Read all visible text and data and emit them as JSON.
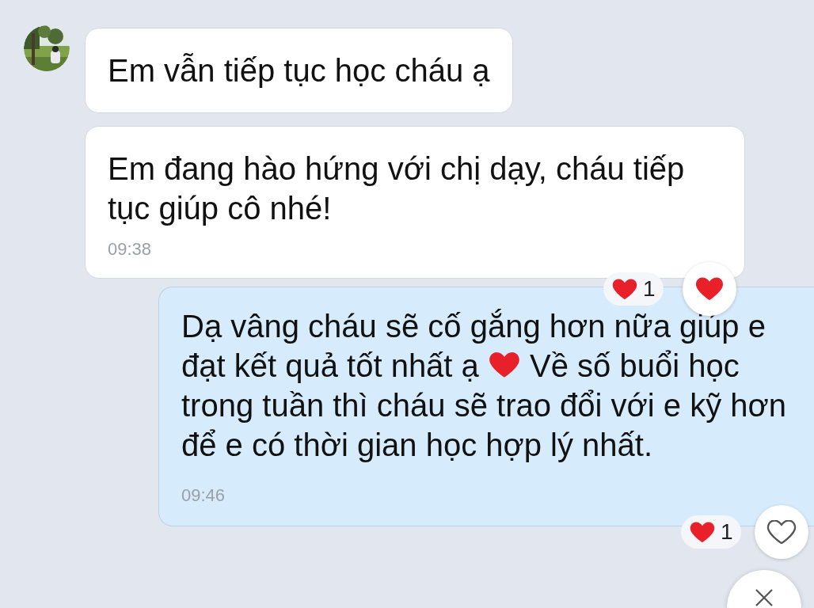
{
  "messages": [
    {
      "kind": "incoming",
      "segments": [
        {
          "kind": "text",
          "text": "Em vẫn tiếp tục học cháu ạ"
        }
      ]
    },
    {
      "kind": "incoming",
      "segments": [
        {
          "kind": "text",
          "text": "Em đang hào hứng với chị dạy, cháu tiếp tục giúp cô nhé!"
        }
      ],
      "time": "09:38",
      "reaction_count": "1",
      "reacted": true
    },
    {
      "kind": "outgoing",
      "segments": [
        {
          "kind": "text",
          "text": "Dạ vâng cháu sẽ cố gắng hơn nữa giúp e đạt kết quả tốt nhất ạ "
        },
        {
          "kind": "heart"
        },
        {
          "kind": "text",
          "text": " Về số buổi học trong tuần thì cháu sẽ trao đổi với e kỹ hơn để e có thời gian học hợp lý nhất."
        }
      ],
      "time": "09:46",
      "reaction_count": "1",
      "reacted": false,
      "close_button": true
    }
  ]
}
